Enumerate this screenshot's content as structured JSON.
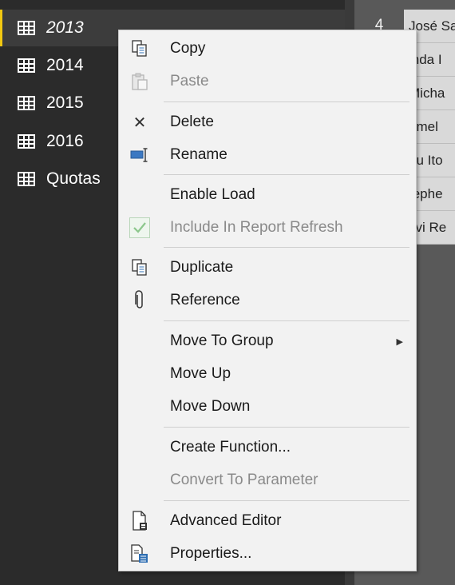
{
  "queries": {
    "items": [
      {
        "label": "2013",
        "selected": true
      },
      {
        "label": "2014"
      },
      {
        "label": "2015"
      },
      {
        "label": "2016"
      },
      {
        "label": "Quotas"
      }
    ]
  },
  "grid": {
    "row_number": "4",
    "cells": [
      "José Sa",
      "inda I",
      "Micha",
      "amel",
      "hu Ito",
      "tephe",
      "svi Re"
    ]
  },
  "menu": {
    "copy": "Copy",
    "paste": "Paste",
    "delete": "Delete",
    "rename": "Rename",
    "enable_load": "Enable Load",
    "include_refresh": "Include In Report Refresh",
    "duplicate": "Duplicate",
    "reference": "Reference",
    "move_to_group": "Move To Group",
    "move_up": "Move Up",
    "move_down": "Move Down",
    "create_function": "Create Function...",
    "convert_parameter": "Convert To Parameter",
    "advanced_editor": "Advanced Editor",
    "properties": "Properties...",
    "submenu_arrow": "▶",
    "delete_icon": "✕"
  },
  "icons": {
    "table": "table-icon",
    "copy": "copy-icon",
    "paste": "paste-icon",
    "delete": "close-icon",
    "rename": "rename-icon",
    "checkbox": "checkbox-checked-icon",
    "duplicate": "duplicate-icon",
    "reference": "paperclip-icon",
    "advanced_editor": "document-editor-icon",
    "properties": "properties-icon"
  },
  "colors": {
    "pane_background": "#2b2b2b",
    "menu_background": "#f2f2f2",
    "selection_accent": "#f2c811",
    "disabled_text": "#8a8a8a",
    "check_green": "#5cb85c"
  }
}
